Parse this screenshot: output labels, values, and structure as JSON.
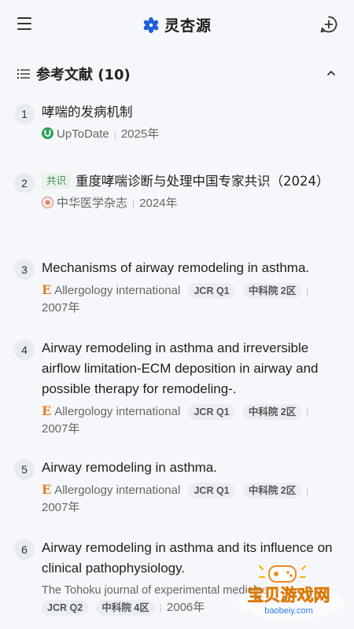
{
  "app": {
    "name": "灵杏源"
  },
  "section": {
    "title": "参考文献 (10)"
  },
  "references": [
    {
      "num": "1",
      "title": "哮喘的发病机制",
      "source": "UpToDate",
      "year": "2025年"
    },
    {
      "num": "2",
      "badge": "共识",
      "title": "重度哮喘诊断与处理中国专家共识（2024）",
      "source": "中华医学杂志",
      "year": "2024年"
    },
    {
      "num": "3",
      "title": "Mechanisms of airway remodeling in asthma.",
      "source": "Allergology international",
      "tags": [
        "JCR Q1",
        "中科院 2区"
      ],
      "year": "2007年"
    },
    {
      "num": "4",
      "title": "Airway remodeling in asthma and irreversible airflow limitation-ECM deposition in airway and possible therapy for remodeling-.",
      "source": "Allergology international",
      "tags": [
        "JCR Q1",
        "中科院 2区"
      ],
      "year": "2007年"
    },
    {
      "num": "5",
      "title": "Airway remodeling in asthma.",
      "source": "Allergology international",
      "tags": [
        "JCR Q1",
        "中科院 2区"
      ],
      "year": "2007年"
    },
    {
      "num": "6",
      "title": "Airway remodeling in asthma and its influence on clinical pathophysiology.",
      "source": "The Tohoku journal of experimental medicine",
      "tags": [
        "JCR Q2",
        "中科院 4区"
      ],
      "year": "2006年"
    }
  ],
  "watermark": {
    "text": "宝贝游戏网",
    "url": "baobeiy.com"
  },
  "colors": {
    "accent": "#1f5fd6",
    "panel_bg": "#f5f7fa",
    "tag_bg": "#eaeef3",
    "badge_green": "#3a8a56",
    "elsevier_orange": "#e67e22"
  }
}
